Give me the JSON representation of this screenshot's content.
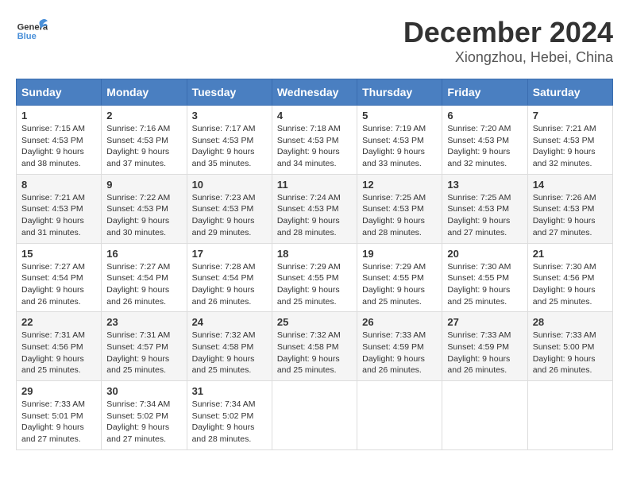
{
  "header": {
    "logo_line1": "General",
    "logo_line2": "Blue",
    "title": "December 2024",
    "subtitle": "Xiongzhou, Hebei, China"
  },
  "days_of_week": [
    "Sunday",
    "Monday",
    "Tuesday",
    "Wednesday",
    "Thursday",
    "Friday",
    "Saturday"
  ],
  "weeks": [
    [
      {
        "day": "1",
        "sunrise": "7:15 AM",
        "sunset": "4:53 PM",
        "daylight": "9 hours and 38 minutes."
      },
      {
        "day": "2",
        "sunrise": "7:16 AM",
        "sunset": "4:53 PM",
        "daylight": "9 hours and 37 minutes."
      },
      {
        "day": "3",
        "sunrise": "7:17 AM",
        "sunset": "4:53 PM",
        "daylight": "9 hours and 35 minutes."
      },
      {
        "day": "4",
        "sunrise": "7:18 AM",
        "sunset": "4:53 PM",
        "daylight": "9 hours and 34 minutes."
      },
      {
        "day": "5",
        "sunrise": "7:19 AM",
        "sunset": "4:53 PM",
        "daylight": "9 hours and 33 minutes."
      },
      {
        "day": "6",
        "sunrise": "7:20 AM",
        "sunset": "4:53 PM",
        "daylight": "9 hours and 32 minutes."
      },
      {
        "day": "7",
        "sunrise": "7:21 AM",
        "sunset": "4:53 PM",
        "daylight": "9 hours and 32 minutes."
      }
    ],
    [
      {
        "day": "8",
        "sunrise": "7:21 AM",
        "sunset": "4:53 PM",
        "daylight": "9 hours and 31 minutes."
      },
      {
        "day": "9",
        "sunrise": "7:22 AM",
        "sunset": "4:53 PM",
        "daylight": "9 hours and 30 minutes."
      },
      {
        "day": "10",
        "sunrise": "7:23 AM",
        "sunset": "4:53 PM",
        "daylight": "9 hours and 29 minutes."
      },
      {
        "day": "11",
        "sunrise": "7:24 AM",
        "sunset": "4:53 PM",
        "daylight": "9 hours and 28 minutes."
      },
      {
        "day": "12",
        "sunrise": "7:25 AM",
        "sunset": "4:53 PM",
        "daylight": "9 hours and 28 minutes."
      },
      {
        "day": "13",
        "sunrise": "7:25 AM",
        "sunset": "4:53 PM",
        "daylight": "9 hours and 27 minutes."
      },
      {
        "day": "14",
        "sunrise": "7:26 AM",
        "sunset": "4:53 PM",
        "daylight": "9 hours and 27 minutes."
      }
    ],
    [
      {
        "day": "15",
        "sunrise": "7:27 AM",
        "sunset": "4:54 PM",
        "daylight": "9 hours and 26 minutes."
      },
      {
        "day": "16",
        "sunrise": "7:27 AM",
        "sunset": "4:54 PM",
        "daylight": "9 hours and 26 minutes."
      },
      {
        "day": "17",
        "sunrise": "7:28 AM",
        "sunset": "4:54 PM",
        "daylight": "9 hours and 26 minutes."
      },
      {
        "day": "18",
        "sunrise": "7:29 AM",
        "sunset": "4:55 PM",
        "daylight": "9 hours and 25 minutes."
      },
      {
        "day": "19",
        "sunrise": "7:29 AM",
        "sunset": "4:55 PM",
        "daylight": "9 hours and 25 minutes."
      },
      {
        "day": "20",
        "sunrise": "7:30 AM",
        "sunset": "4:55 PM",
        "daylight": "9 hours and 25 minutes."
      },
      {
        "day": "21",
        "sunrise": "7:30 AM",
        "sunset": "4:56 PM",
        "daylight": "9 hours and 25 minutes."
      }
    ],
    [
      {
        "day": "22",
        "sunrise": "7:31 AM",
        "sunset": "4:56 PM",
        "daylight": "9 hours and 25 minutes."
      },
      {
        "day": "23",
        "sunrise": "7:31 AM",
        "sunset": "4:57 PM",
        "daylight": "9 hours and 25 minutes."
      },
      {
        "day": "24",
        "sunrise": "7:32 AM",
        "sunset": "4:58 PM",
        "daylight": "9 hours and 25 minutes."
      },
      {
        "day": "25",
        "sunrise": "7:32 AM",
        "sunset": "4:58 PM",
        "daylight": "9 hours and 25 minutes."
      },
      {
        "day": "26",
        "sunrise": "7:33 AM",
        "sunset": "4:59 PM",
        "daylight": "9 hours and 26 minutes."
      },
      {
        "day": "27",
        "sunrise": "7:33 AM",
        "sunset": "4:59 PM",
        "daylight": "9 hours and 26 minutes."
      },
      {
        "day": "28",
        "sunrise": "7:33 AM",
        "sunset": "5:00 PM",
        "daylight": "9 hours and 26 minutes."
      }
    ],
    [
      {
        "day": "29",
        "sunrise": "7:33 AM",
        "sunset": "5:01 PM",
        "daylight": "9 hours and 27 minutes."
      },
      {
        "day": "30",
        "sunrise": "7:34 AM",
        "sunset": "5:02 PM",
        "daylight": "9 hours and 27 minutes."
      },
      {
        "day": "31",
        "sunrise": "7:34 AM",
        "sunset": "5:02 PM",
        "daylight": "9 hours and 28 minutes."
      },
      null,
      null,
      null,
      null
    ]
  ],
  "labels": {
    "sunrise": "Sunrise:",
    "sunset": "Sunset:",
    "daylight": "Daylight:"
  }
}
